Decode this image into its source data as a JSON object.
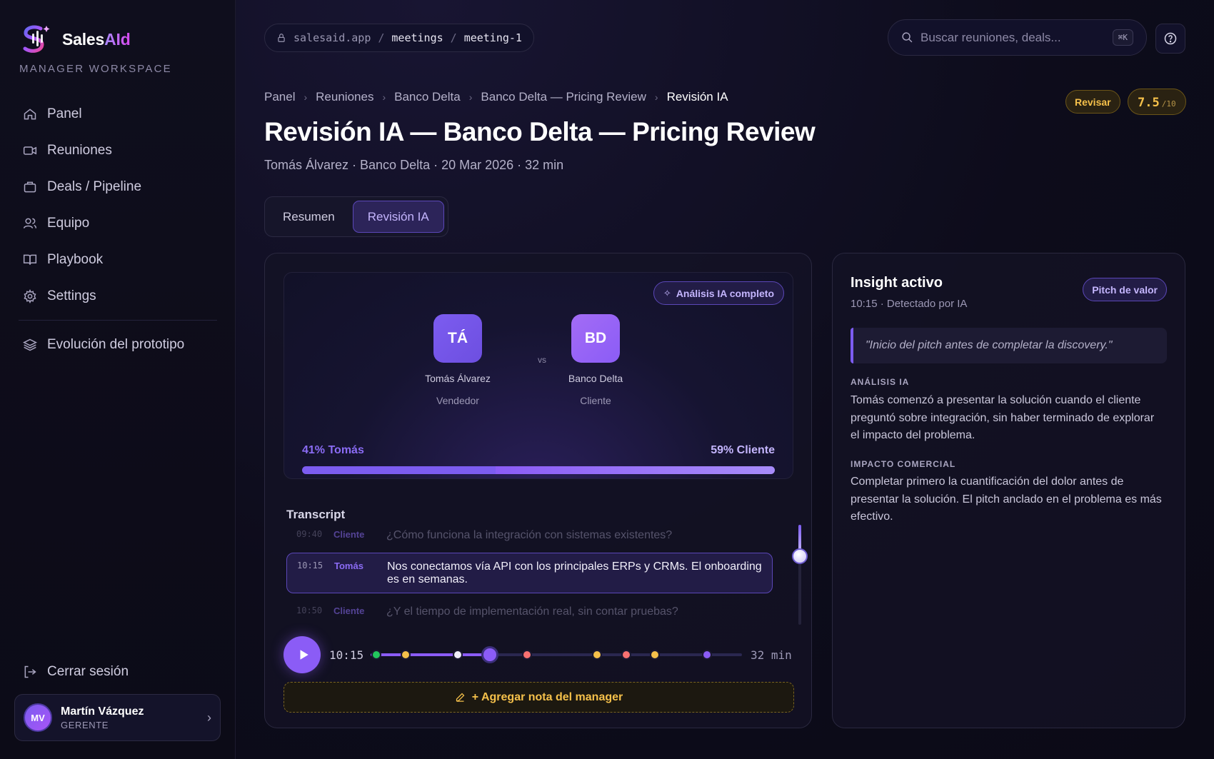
{
  "sidebar": {
    "brand": {
      "name_prefix": "Sales",
      "name_suffix": "AId"
    },
    "workspace": "MANAGER WORKSPACE",
    "nav": [
      {
        "label": "Panel",
        "icon": "home-icon"
      },
      {
        "label": "Reuniones",
        "icon": "video-icon"
      },
      {
        "label": "Deals / Pipeline",
        "icon": "briefcase-icon"
      },
      {
        "label": "Equipo",
        "icon": "users-icon"
      },
      {
        "label": "Playbook",
        "icon": "book-icon"
      },
      {
        "label": "Settings",
        "icon": "gear-icon"
      }
    ],
    "secondary": {
      "label": "Evolución del prototipo",
      "icon": "layers-icon"
    },
    "logout": "Cerrar sesión",
    "user": {
      "initials": "MV",
      "name": "Martín Vázquez",
      "role": "GERENTE"
    }
  },
  "header": {
    "url": {
      "host": "salesaid.app",
      "sep": "/",
      "seg1": "meetings",
      "seg2": "meeting-1"
    },
    "search": {
      "placeholder": "Buscar reuniones, deals...",
      "shortcut": "⌘K"
    }
  },
  "breadcrumb": [
    "Panel",
    "Reuniones",
    "Banco Delta",
    "Banco Delta — Pricing Review",
    "Revisión IA"
  ],
  "status": {
    "badge": "Revisar",
    "score": "7.5",
    "score_max": "/10"
  },
  "page": {
    "title": "Revisión IA — Banco Delta — Pricing Review",
    "subtitle": "Tomás Álvarez · Banco Delta · 20 Mar 2026 · 32 min"
  },
  "tabs": [
    {
      "label": "Resumen",
      "active": false
    },
    {
      "label": "Revisión IA",
      "active": true
    }
  ],
  "meeting": {
    "analysis_badge": "Análisis IA completo",
    "vs": "vs",
    "seller": {
      "initials": "TÁ",
      "name": "Tomás Álvarez",
      "role": "Vendedor",
      "color": "#7c5cf0"
    },
    "client": {
      "initials": "BD",
      "name": "Banco Delta",
      "role": "Cliente",
      "color": "#a36cf5"
    },
    "talk_ratio": {
      "seller_label": "41% Tomás",
      "client_label": "59% Cliente",
      "seller_pct": 41,
      "client_pct": 59
    }
  },
  "transcript": {
    "title": "Transcript",
    "rows": [
      {
        "time": "09:40",
        "speaker": "Cliente",
        "text": "¿Cómo funciona la integración con sistemas existentes?",
        "state": "faded"
      },
      {
        "time": "10:15",
        "speaker": "Tomás",
        "text": "Nos conectamos vía API con los principales ERPs y CRMs. El onboarding es en semanas.",
        "state": "active"
      },
      {
        "time": "10:50",
        "speaker": "Cliente",
        "text": "¿Y el tiempo de implementación real, sin contar pruebas?",
        "state": "faded"
      }
    ],
    "scroll_fraction": 0.28
  },
  "player": {
    "current": "10:15",
    "total": "32 min",
    "progress_fraction": 0.32,
    "markers": [
      {
        "at_minute": 0.5,
        "color": "#22c55e"
      },
      {
        "at_minute": 3.0,
        "color": "#f5c04a"
      },
      {
        "at_minute": 7.5,
        "color": "#f1effa"
      },
      {
        "at_minute": 10.25,
        "color": "#8b5cf6",
        "current": true
      },
      {
        "at_minute": 13.5,
        "color": "#f87171"
      },
      {
        "at_minute": 19.5,
        "color": "#f5c04a"
      },
      {
        "at_minute": 22.0,
        "color": "#f87171"
      },
      {
        "at_minute": 24.5,
        "color": "#f5c04a"
      },
      {
        "at_minute": 29.0,
        "color": "#8b5cf6"
      }
    ],
    "duration_minutes": 32
  },
  "add_note": "+ Agregar nota del manager",
  "insight": {
    "title": "Insight activo",
    "meta": "10:15 · Detectado por IA",
    "badge": "Pitch de valor",
    "quote": "\"Inicio del pitch antes de completar la discovery.\"",
    "analysis_label": "ANÁLISIS IA",
    "analysis_text": "Tomás comenzó a presentar la solución cuando el cliente preguntó sobre integración, sin haber terminado de explorar el impacto del problema.",
    "impact_label": "IMPACTO COMERCIAL",
    "impact_text": "Completar primero la cuantificación del dolor antes de presentar la solución. El pitch anclado en el problema es más efectivo."
  }
}
